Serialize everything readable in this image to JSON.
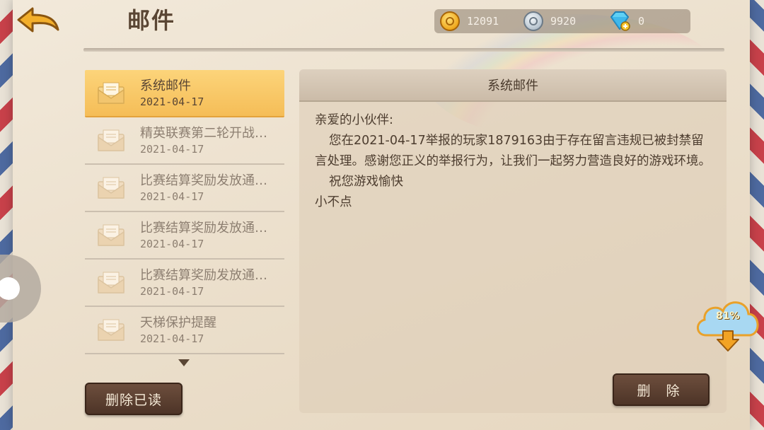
{
  "header": {
    "title": "邮件",
    "currencies": [
      {
        "icon": "gold-coin-icon",
        "value": "12091"
      },
      {
        "icon": "silver-coin-icon",
        "value": "9920"
      },
      {
        "icon": "diamond-plus-icon",
        "value": "0"
      }
    ]
  },
  "mail_list": {
    "items": [
      {
        "subject": "系统邮件",
        "date": "2021-04-17",
        "active": true
      },
      {
        "subject": "精英联赛第二轮开战…",
        "date": "2021-04-17",
        "active": false
      },
      {
        "subject": "比赛结算奖励发放通…",
        "date": "2021-04-17",
        "active": false
      },
      {
        "subject": "比赛结算奖励发放通…",
        "date": "2021-04-17",
        "active": false
      },
      {
        "subject": "比赛结算奖励发放通…",
        "date": "2021-04-17",
        "active": false
      },
      {
        "subject": "天梯保护提醒",
        "date": "2021-04-17",
        "active": false
      }
    ],
    "delete_read_label": "删除已读"
  },
  "content": {
    "title": "系统邮件",
    "greeting": "亲爱的小伙伴:",
    "body": "您在2021-04-17举报的玩家1879163由于存在留言违规已被封禁留言处理。感谢您正义的举报行为，让我们一起努力营造良好的游戏环境。",
    "wish": "祝您游戏愉快",
    "signature": "小不点",
    "delete_label": "删 除"
  },
  "download": {
    "percent": "81%"
  },
  "colors": {
    "accent_active": "#f5bd57",
    "button_dark": "#4d3427",
    "text_main": "#4d3d2f"
  }
}
